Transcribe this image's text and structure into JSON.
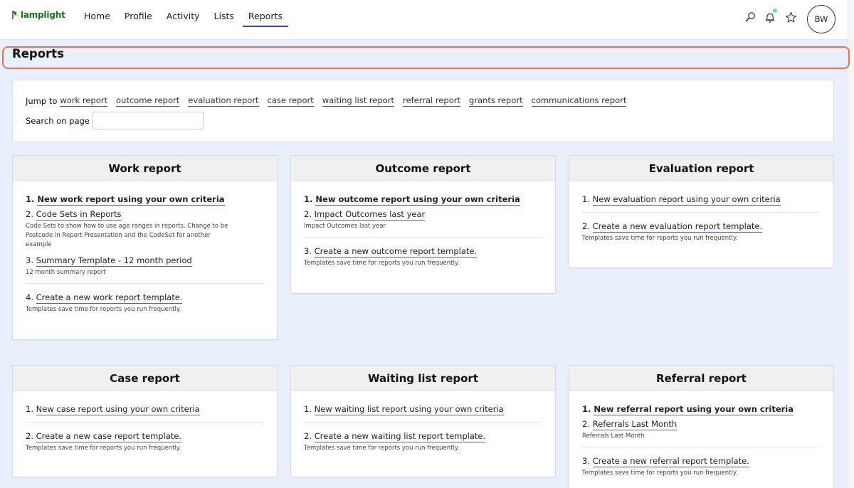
{
  "app": {
    "logo_text": "lamplight",
    "brand_color": "#1a6b2e",
    "accent": "#2d4f9a",
    "highlight": "#e8744b"
  },
  "nav": {
    "items": [
      {
        "label": "Home"
      },
      {
        "label": "Profile"
      },
      {
        "label": "Activity"
      },
      {
        "label": "Lists"
      },
      {
        "label": "Reports",
        "active": true
      }
    ]
  },
  "header_icons": [
    "search-icon",
    "bell-icon",
    "star-icon"
  ],
  "user": {
    "initials": "BW"
  },
  "page": {
    "title": "Reports"
  },
  "jump": {
    "label": "Jump to",
    "links": [
      "work report",
      "outcome report",
      "evaluation report",
      "case report",
      "waiting list report",
      "referral report",
      "grants report",
      "communications report"
    ],
    "search_label": "Search on page",
    "search_value": ""
  },
  "cards": {
    "work": {
      "title": "Work report",
      "items": [
        {
          "num": "1.",
          "label": "New work report using your own criteria",
          "bold": true
        },
        {
          "num": "2.",
          "label": "Code Sets in Reports",
          "desc": "Code Sets to show how to use age ranges in reports. Change to be Postcode in Report Presentation and the CodeSet for another example"
        },
        {
          "num": "3.",
          "label": "Summary Template - 12 month period",
          "desc": "12 month summary report"
        }
      ],
      "template": {
        "num": "4.",
        "label": "Create a new work report template.",
        "desc": "Templates save time for reports you run frequently."
      }
    },
    "outcome": {
      "title": "Outcome report",
      "items": [
        {
          "num": "1.",
          "label": "New outcome report using your own criteria",
          "bold": true
        },
        {
          "num": "2.",
          "label": "Impact Outcomes last year",
          "desc": "Impact Outcomes last year"
        }
      ],
      "template": {
        "num": "3.",
        "label": "Create a new outcome report template.",
        "desc": "Templates save time for reports you run frequently."
      }
    },
    "evaluation": {
      "title": "Evaluation report",
      "items": [
        {
          "num": "1.",
          "label": "New evaluation report using your own criteria"
        }
      ],
      "template": {
        "num": "2.",
        "label": "Create a new evaluation report template.",
        "desc": "Templates save time for reports you run frequently."
      }
    },
    "case": {
      "title": "Case report",
      "items": [
        {
          "num": "1.",
          "label": "New case report using your own criteria"
        }
      ],
      "template": {
        "num": "2.",
        "label": "Create a new case report template.",
        "desc": "Templates save time for reports you run frequently."
      }
    },
    "waiting": {
      "title": "Waiting list report",
      "items": [
        {
          "num": "1.",
          "label": "New waiting list report using your own criteria"
        }
      ],
      "template": {
        "num": "2.",
        "label": "Create a new waiting list report template.",
        "desc": "Templates save time for reports you run frequently."
      }
    },
    "referral": {
      "title": "Referral report",
      "items": [
        {
          "num": "1.",
          "label": "New referral report using your own criteria",
          "bold": true
        },
        {
          "num": "2.",
          "label": "Referrals Last Month",
          "desc": "Referrals Last Month"
        }
      ],
      "template": {
        "num": "3.",
        "label": "Create a new referral report template.",
        "desc": "Templates save time for reports you run frequently."
      }
    }
  }
}
